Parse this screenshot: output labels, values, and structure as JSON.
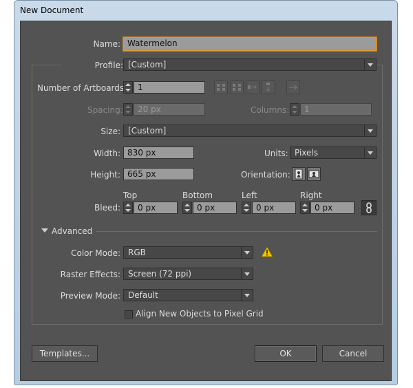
{
  "window": {
    "title": "New Document"
  },
  "name": {
    "label": "Name:",
    "value": "Watermelon"
  },
  "profile": {
    "label": "Profile:",
    "value": "[Custom]"
  },
  "artboards": {
    "label": "Number of Artboards:",
    "value": "1"
  },
  "spacing": {
    "label": "Spacing:",
    "value": "20 px"
  },
  "columns": {
    "label": "Columns:",
    "value": "1"
  },
  "size": {
    "label": "Size:",
    "value": "[Custom]"
  },
  "width": {
    "label": "Width:",
    "value": "830 px"
  },
  "units": {
    "label": "Units:",
    "value": "Pixels"
  },
  "height": {
    "label": "Height:",
    "value": "665 px"
  },
  "orientation": {
    "label": "Orientation:"
  },
  "bleed": {
    "label": "Bleed:",
    "top": {
      "label": "Top",
      "value": "0 px"
    },
    "bottom": {
      "label": "Bottom",
      "value": "0 px"
    },
    "left": {
      "label": "Left",
      "value": "0 px"
    },
    "right": {
      "label": "Right",
      "value": "0 px"
    }
  },
  "advanced": {
    "label": "Advanced",
    "color_mode": {
      "label": "Color Mode:",
      "value": "RGB"
    },
    "raster_effects": {
      "label": "Raster Effects:",
      "value": "Screen (72 ppi)"
    },
    "preview_mode": {
      "label": "Preview Mode:",
      "value": "Default"
    },
    "align_grid": {
      "label": "Align New Objects to Pixel Grid",
      "checked": false
    }
  },
  "buttons": {
    "templates": "Templates...",
    "ok": "OK",
    "cancel": "Cancel"
  },
  "colors": {
    "dialog_bg": "#535353",
    "field_bg": "#9b9b9b",
    "focus": "#e29a2c",
    "warning": "#f2c500"
  }
}
